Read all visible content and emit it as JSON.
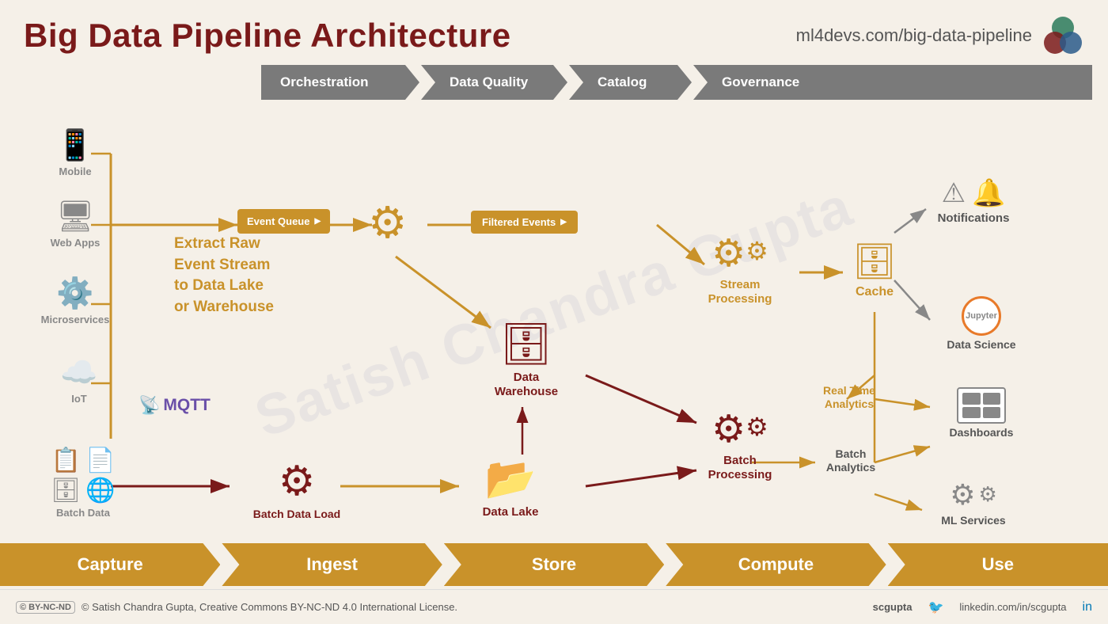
{
  "header": {
    "title": "Big Data Pipeline Architecture",
    "url": "ml4devs.com/big-data-pipeline"
  },
  "top_banner": {
    "items": [
      "Orchestration",
      "Data Quality",
      "Catalog",
      "Governance"
    ]
  },
  "sources": [
    {
      "label": "Mobile",
      "icon": "📱"
    },
    {
      "label": "Web Apps",
      "icon": "💻"
    },
    {
      "label": "Microservices",
      "icon": "⚙"
    },
    {
      "label": "IoT",
      "icon": "☁"
    }
  ],
  "batch_sources": [
    {
      "label": "Batch Data",
      "icon": "📋"
    }
  ],
  "nodes": {
    "event_queue": "Event Queue",
    "filtered_events": "Filtered Events",
    "stream_processing": "Stream Processing",
    "cache": "Cache",
    "data_warehouse": "Data\nWarehouse",
    "batch_data_load": "Batch Data Load",
    "data_lake": "Data Lake",
    "batch_processing": "Batch\nProcessing",
    "notifications": "Notifications",
    "data_science": "Data Science",
    "real_time_analytics": "Real Time\nAnalytics",
    "batch_analytics": "Batch\nAnalytics",
    "dashboards": "Dashboards",
    "ml_services": "ML Services"
  },
  "extract_text": "Extract Raw\nEvent Stream\nto Data Lake\nor Warehouse",
  "mqtt_label": "MQTT",
  "pipeline_stages": [
    "Capture",
    "Ingest",
    "Store",
    "Compute",
    "Use"
  ],
  "footer": {
    "copyright": "© Satish Chandra Gupta, Creative Commons BY-NC-ND 4.0 International License.",
    "cc_label": "BY-NC-ND",
    "social1": "scgupta",
    "social2": "linkedin.com/in/scgupta"
  },
  "watermark": "Satish Chandra Gupta"
}
